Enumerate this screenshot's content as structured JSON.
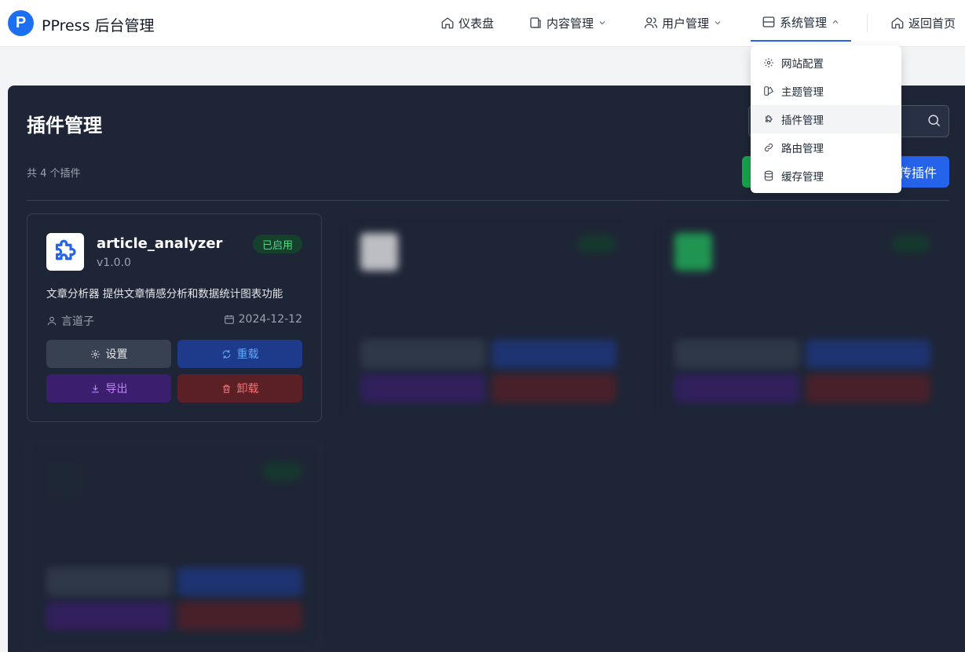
{
  "app": {
    "logo_letter": "P",
    "title": "PPress 后台管理"
  },
  "nav": {
    "dashboard": "仪表盘",
    "content": "内容管理",
    "users": "用户管理",
    "system": "系统管理",
    "home": "返回首页"
  },
  "system_menu": [
    {
      "label": "网站配置",
      "icon": "gear-icon"
    },
    {
      "label": "主题管理",
      "icon": "theme-icon"
    },
    {
      "label": "插件管理",
      "icon": "puzzle-icon"
    },
    {
      "label": "路由管理",
      "icon": "link-icon"
    },
    {
      "label": "缓存管理",
      "icon": "database-icon"
    }
  ],
  "page": {
    "title": "插件管理",
    "count_text": "共 4 个插件",
    "upload_label": "传插件"
  },
  "plugins": [
    {
      "name": "article_analyzer",
      "version": "v1.0.0",
      "status": "已启用",
      "description": "文章分析器 提供文章情感分析和数据统计图表功能",
      "author": "言道子",
      "date": "2024-12-12",
      "actions": {
        "settings": "设置",
        "reload": "重载",
        "export": "导出",
        "uninstall": "卸载"
      }
    }
  ],
  "colors": {
    "primary": "#2563eb",
    "panel_bg": "#1e2536",
    "status_green": "#4ade80"
  }
}
